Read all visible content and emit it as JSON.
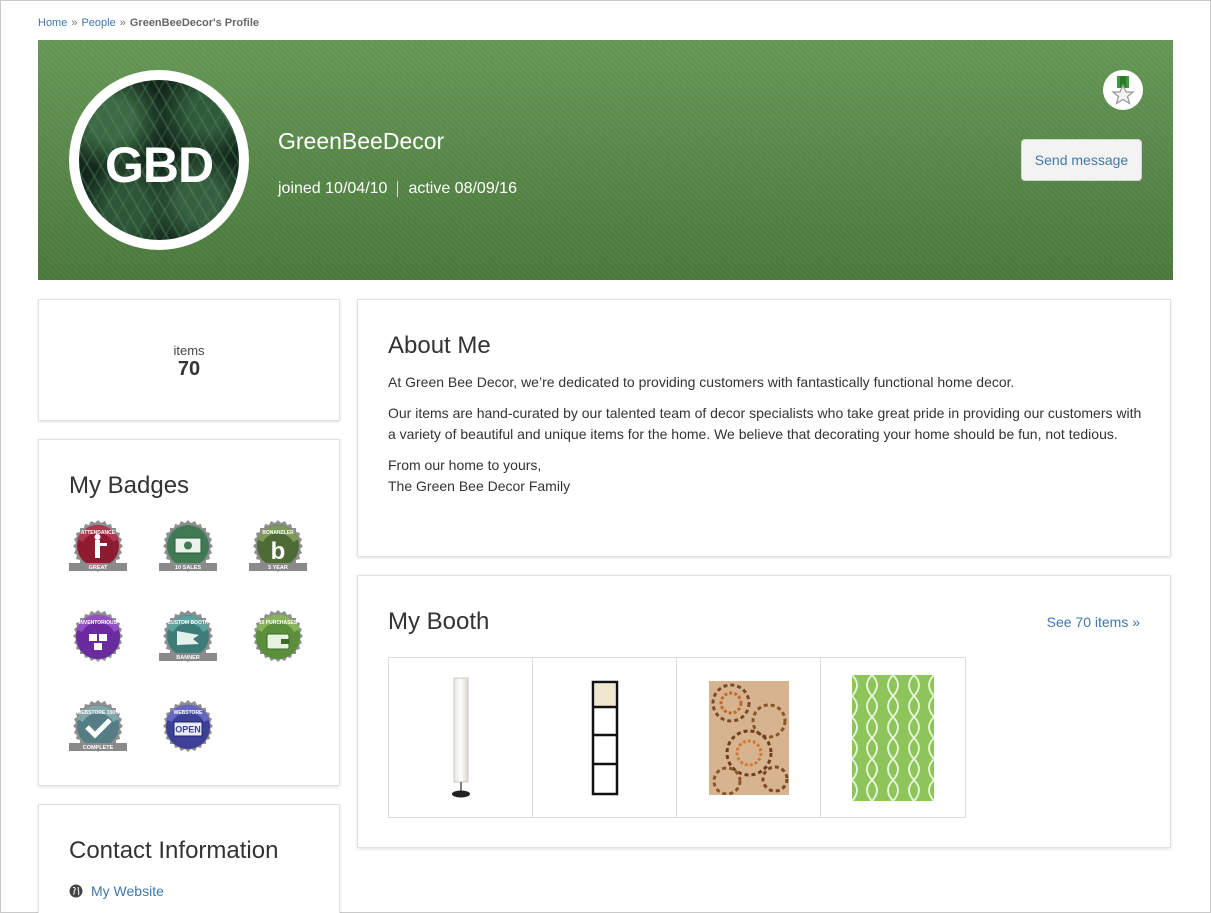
{
  "breadcrumb": {
    "home": "Home",
    "sep1": "»",
    "people": "People",
    "sep2": "»",
    "current": "GreenBeeDecor's Profile"
  },
  "profile": {
    "avatar_text": "GBD",
    "name": "GreenBeeDecor",
    "joined": "joined 10/04/10",
    "active": "active 08/09/16",
    "send_message": "Send message"
  },
  "stats": {
    "items_label": "items",
    "items_count": "70"
  },
  "badges": {
    "title": "My Badges",
    "items": [
      {
        "name": "attendance-badge",
        "top_text": "ATTENDANCE",
        "bottom_text": "GREAT",
        "color": "#8e1b2f"
      },
      {
        "name": "ten-sales-badge",
        "top_text": "",
        "bottom_text": "10 SALES",
        "color": "#3f7a55"
      },
      {
        "name": "bonanzler-badge",
        "top_text": "BONANZLER",
        "bottom_text": "5 YEAR",
        "color": "#4e6b36"
      },
      {
        "name": "inventorious-badge",
        "top_text": "INVENTORIOUS",
        "bottom_text": "",
        "color": "#6a2aa0"
      },
      {
        "name": "custom-booth-badge",
        "top_text": "CUSTOM BOOTH",
        "bottom_text": "BANNER",
        "color": "#3d7c78"
      },
      {
        "name": "ten-purchases-badge",
        "top_text": "10 PURCHASES",
        "bottom_text": "",
        "color": "#5b8f3b"
      },
      {
        "name": "webstore-complete-badge",
        "top_text": "WEBSTORE 100%",
        "bottom_text": "COMPLETE",
        "color": "#557e84"
      },
      {
        "name": "webstore-open-badge",
        "top_text": "WEBSTORE",
        "bottom_text": "OPEN",
        "color": "#3e3f96"
      }
    ]
  },
  "contact": {
    "title": "Contact Information",
    "website": "My Website"
  },
  "about": {
    "title": "About Me",
    "p1": "At Green Bee Decor, we’re dedicated to providing customers with fantastically functional home decor.",
    "p2": "Our items are hand-curated by our talented team of decor specialists who take great pride in providing our customers with a variety of beautiful and unique items for the home. We believe that decorating your home should be fun, not tedious.",
    "p3_line1": "From our home to yours,",
    "p3_line2": "The Green Bee Decor Family"
  },
  "booth": {
    "title": "My Booth",
    "see_items": "See 70 items »",
    "products": [
      "floor-lamp",
      "shelf-floor-lamp",
      "swirl-rug",
      "green-trellis-rug"
    ]
  },
  "colors": {
    "banner": "#5a8a4b",
    "link": "#3f77ab",
    "text": "#333333"
  }
}
